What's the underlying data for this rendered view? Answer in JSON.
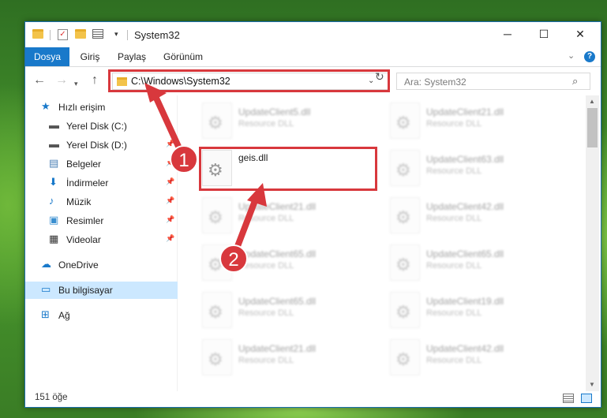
{
  "window": {
    "title": "System32",
    "controls": {
      "minimize": "─",
      "maximize": "☐",
      "close": "✕"
    }
  },
  "ribbon": {
    "tabs": [
      "Dosya",
      "Giriş",
      "Paylaş",
      "Görünüm"
    ]
  },
  "nav": {
    "address": "C:\\Windows\\System32",
    "search_placeholder": "Ara: System32"
  },
  "sidebar": {
    "items": [
      {
        "label": "Hızlı erişim",
        "icon": "star-icon",
        "pinned": false
      },
      {
        "label": "Yerel Disk (C:)",
        "icon": "drive-icon",
        "pinned": false
      },
      {
        "label": "Yerel Disk (D:)",
        "icon": "drive-icon",
        "pinned": true
      },
      {
        "label": "Belgeler",
        "icon": "documents-icon",
        "pinned": true
      },
      {
        "label": "İndirmeler",
        "icon": "download-icon",
        "pinned": true
      },
      {
        "label": "Müzik",
        "icon": "music-icon",
        "pinned": true
      },
      {
        "label": "Resimler",
        "icon": "pictures-icon",
        "pinned": true
      },
      {
        "label": "Videolar",
        "icon": "videos-icon",
        "pinned": true
      },
      {
        "label": "OneDrive",
        "icon": "cloud-icon",
        "pinned": false
      },
      {
        "label": "Bu bilgisayar",
        "icon": "computer-icon",
        "pinned": false,
        "selected": true
      },
      {
        "label": "Ağ",
        "icon": "network-icon",
        "pinned": false
      }
    ]
  },
  "files": [
    {
      "name": "UpdateClient5.dll",
      "type": "Resource DLL"
    },
    {
      "name": "UpdateClient21.dll",
      "type": "Resource DLL"
    },
    {
      "name": "geis.dll",
      "type": "",
      "highlighted": true
    },
    {
      "name": "UpdateClient63.dll",
      "type": "Resource DLL"
    },
    {
      "name": "UpdateClient21.dll",
      "type": "Resource DLL"
    },
    {
      "name": "UpdateClient42.dll",
      "type": "Resource DLL"
    },
    {
      "name": "UpdateClient65.dll",
      "type": "Resource DLL"
    },
    {
      "name": "UpdateClient65.dll",
      "type": "Resource DLL"
    },
    {
      "name": "UpdateClient65.dll",
      "type": "Resource DLL"
    },
    {
      "name": "UpdateClient19.dll",
      "type": "Resource DLL"
    },
    {
      "name": "UpdateClient21.dll",
      "type": "Resource DLL"
    },
    {
      "name": "UpdateClient42.dll",
      "type": "Resource DLL"
    }
  ],
  "status": {
    "item_count": "151 öğe"
  },
  "annotations": {
    "badge1": "1",
    "badge2": "2",
    "color": "#d8383d"
  },
  "colors": {
    "accent": "#1979ca",
    "selection": "#cce8ff",
    "highlight": "#d8383d"
  }
}
